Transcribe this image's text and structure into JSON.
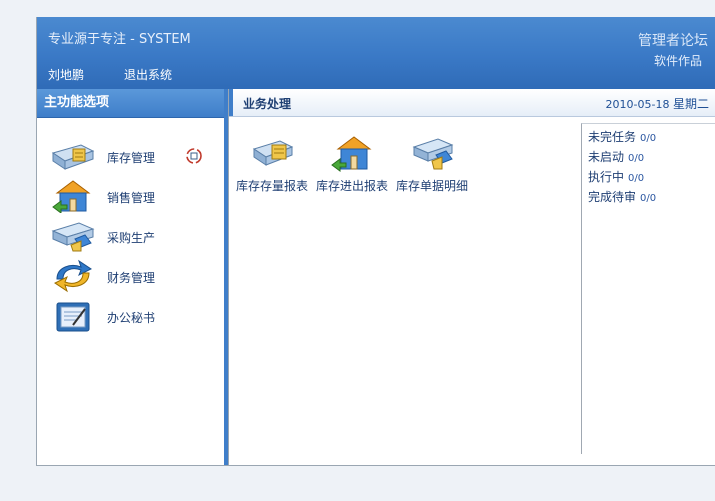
{
  "header": {
    "title": "专业源于专注 - SYSTEM",
    "user": "刘地鹏",
    "logout": "退出系统",
    "forum": "管理者论坛",
    "works": "软件作品"
  },
  "sidebar": {
    "title": "主功能选项",
    "items": [
      {
        "label": "库存管理",
        "icon": "inventory-icon"
      },
      {
        "label": "销售管理",
        "icon": "sales-house-icon"
      },
      {
        "label": "采购生产",
        "icon": "purchase-icon"
      },
      {
        "label": "财务管理",
        "icon": "finance-icon"
      },
      {
        "label": "办公秘书",
        "icon": "office-icon"
      }
    ]
  },
  "main": {
    "title": "业务处理",
    "date": "2010-05-18",
    "weekday": "星期二",
    "functions": [
      {
        "label": "库存存量报表",
        "icon": "stock-report-icon"
      },
      {
        "label": "库存进出报表",
        "icon": "in-out-report-icon"
      },
      {
        "label": "库存单据明细",
        "icon": "doc-detail-icon"
      }
    ]
  },
  "tasks": [
    {
      "label": "未完任务",
      "count": "0/0"
    },
    {
      "label": "未启动",
      "count": "0/0"
    },
    {
      "label": "执行中",
      "count": "0/0"
    },
    {
      "label": "完成待审",
      "count": "0/0"
    }
  ],
  "colors": {
    "header_blue": "#3a79c6",
    "accent": "#3f7ec9",
    "link_text": "#1f3f73"
  }
}
